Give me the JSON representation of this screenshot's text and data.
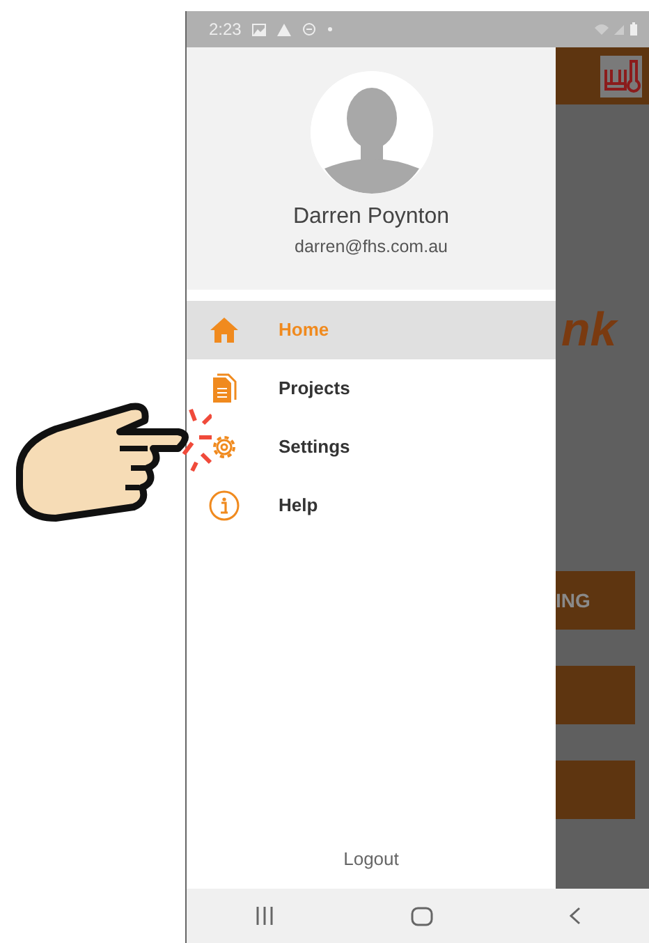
{
  "status_bar": {
    "time": "2:23"
  },
  "profile": {
    "name": "Darren Poynton",
    "email": "darren@fhs.com.au"
  },
  "menu": [
    {
      "label": "Home",
      "kind": "home",
      "selected": true
    },
    {
      "label": "Projects",
      "kind": "document",
      "selected": false
    },
    {
      "label": "Settings",
      "kind": "gear",
      "selected": false
    },
    {
      "label": "Help",
      "kind": "info",
      "selected": false
    }
  ],
  "logout": "Logout",
  "background_app": {
    "title_fragment": "nk",
    "buttons": [
      {
        "kind": "text",
        "label": "ING"
      },
      {
        "kind": "blank"
      },
      {
        "kind": "blank"
      }
    ]
  },
  "annotation": {
    "kind": "pointing-hand"
  }
}
